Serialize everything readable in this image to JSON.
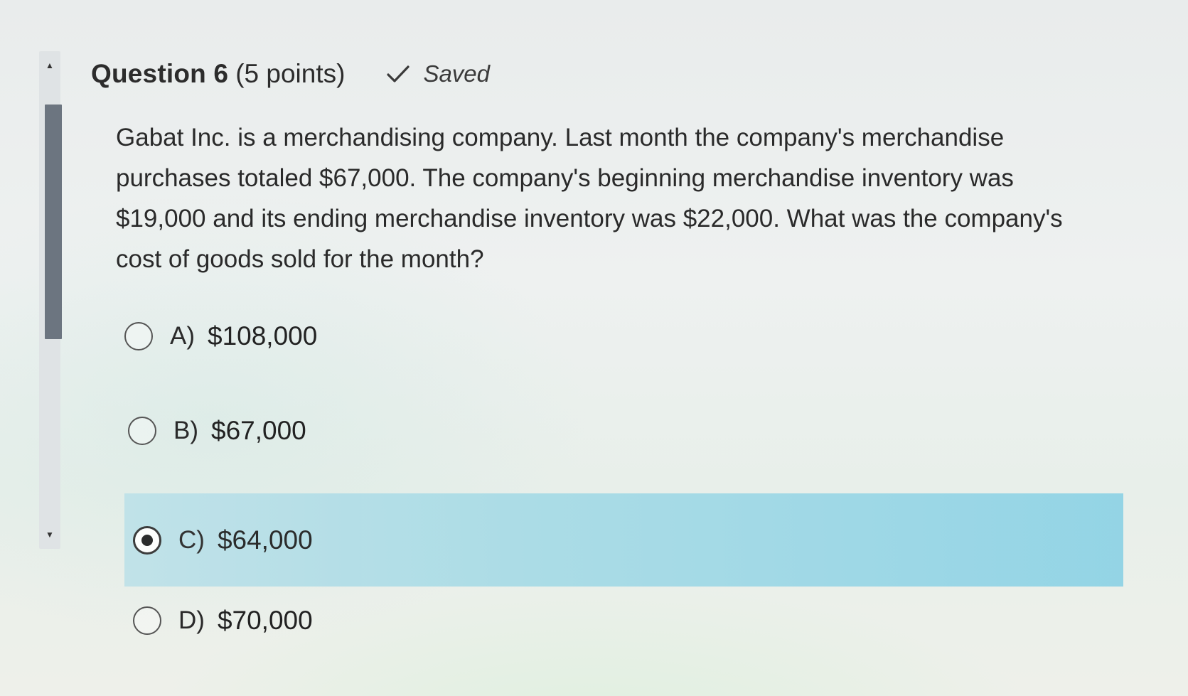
{
  "question": {
    "title": "Question 6",
    "points": "(5 points)",
    "status": "Saved",
    "status_icon": "check-icon",
    "text": "Gabat Inc. is a merchandising company. Last month the company's merchandise purchases totaled $67,000. The company's beginning merchandise inventory was $19,000 and its ending merchandise inventory was $22,000. What was the company's cost of goods sold for the month?"
  },
  "options": [
    {
      "letter": "A)",
      "value": "$108,000",
      "selected": false
    },
    {
      "letter": "B)",
      "value": "$67,000",
      "selected": false
    },
    {
      "letter": "C)",
      "value": "$64,000",
      "selected": true
    },
    {
      "letter": "D)",
      "value": "$70,000",
      "selected": false
    }
  ],
  "colors": {
    "selected_highlight": "#a8dbe6",
    "scroll_thumb": "#6c7580"
  }
}
